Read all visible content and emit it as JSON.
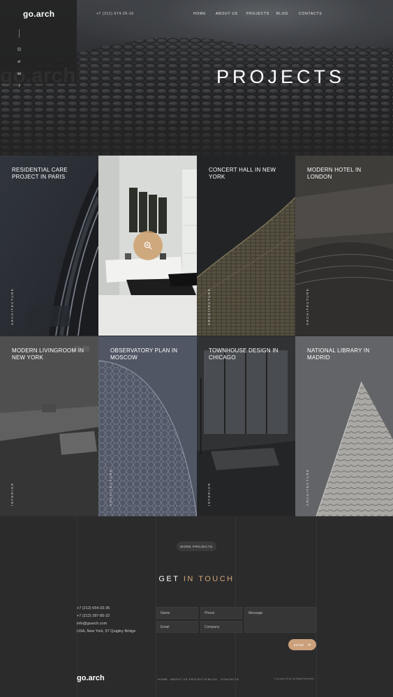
{
  "header": {
    "logo": "go.arch",
    "phone": "+7 (212) 674-25-10",
    "nav": [
      "HOME",
      "ABOUT US",
      "PROJECTS",
      "BLOG",
      "CONTACTS"
    ]
  },
  "hero": {
    "title": "PROJECTS",
    "ghost_text": "go.arch"
  },
  "social": [
    "instagram-icon",
    "twitter-icon",
    "youtube-icon",
    "facebook-icon"
  ],
  "projects": [
    {
      "title": "RESIDENTIAL CARE PROJECT IN PARIS",
      "category": "ARCHITECTURE"
    },
    {
      "title": "",
      "category": ""
    },
    {
      "title": "CONCERT HALL IN NEW YORK",
      "category": "ARCHITECTURE"
    },
    {
      "title": "MODERN HOTEL IN LONDON",
      "category": "ARCHITECTURE"
    },
    {
      "title": "MODERN LIVINGROOM IN NEW YORK",
      "category": "INTERIOR"
    },
    {
      "title": "OBSERVATORY PLAN IN MOSCOW",
      "category": "ARCHITECTURE"
    },
    {
      "title": "TOWNHOUSE DESIGN IN CHICAGO",
      "category": "INTERIOR"
    },
    {
      "title": "NATIONAL LIBRARY IN MADRID",
      "category": "ARCHITECTURE"
    }
  ],
  "more_projects_label": "MORE PROJECTS",
  "get_in_touch": {
    "part1": "GET",
    "part2": "IN TOUCH"
  },
  "contact": {
    "phone1": "+7 (212) 654-33-35",
    "phone2": "+7 (212) 287-85-22",
    "email": "info@goarch.com",
    "address": "USA, New York, 57 Quigley Bridge"
  },
  "form": {
    "name": "Name",
    "phone": "Phone",
    "message": "Message",
    "email": "Email",
    "company": "Company",
    "send": "SEND"
  },
  "footer": {
    "logo": "go.arch",
    "nav": [
      "HOME",
      "ABOUT US",
      "PROJECTS",
      "BLOG",
      "CONTACTS"
    ],
    "copyright": "© go.arch 2016. All Rights Reserved"
  },
  "colors": {
    "accent": "#cba07a",
    "background": "#2b2b2b"
  }
}
